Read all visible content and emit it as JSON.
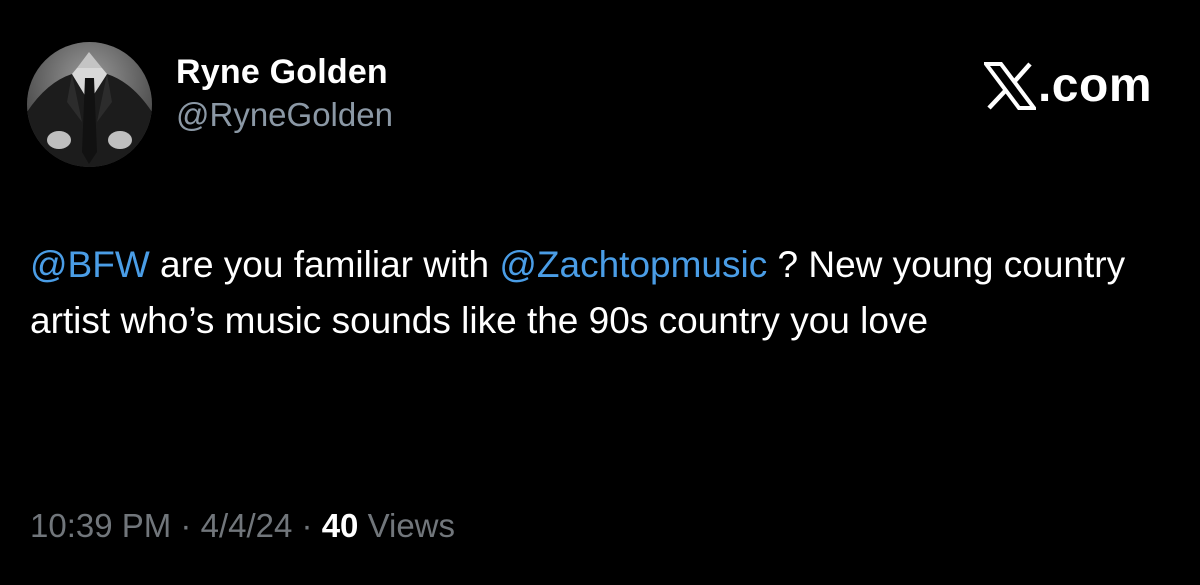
{
  "author": {
    "display_name": "Ryne Golden",
    "handle": "@RyneGolden"
  },
  "brand": {
    "text": ".com",
    "icon": "x-logo-icon"
  },
  "tweet": {
    "parts": [
      {
        "type": "mention",
        "text": "@BFW"
      },
      {
        "type": "text",
        "text": " are you familiar with "
      },
      {
        "type": "mention",
        "text": "@Zachtopmusic"
      },
      {
        "type": "text",
        "text": " ? New young country artist who’s music sounds like the 90s country you love"
      }
    ]
  },
  "meta": {
    "time": "10:39 PM",
    "separator": "·",
    "date": "4/4/24",
    "views_count": "40",
    "views_label": "Views"
  },
  "colors": {
    "background": "#000000",
    "text": "#ffffff",
    "secondary": "#71767b",
    "mention": "#4a9de6"
  }
}
